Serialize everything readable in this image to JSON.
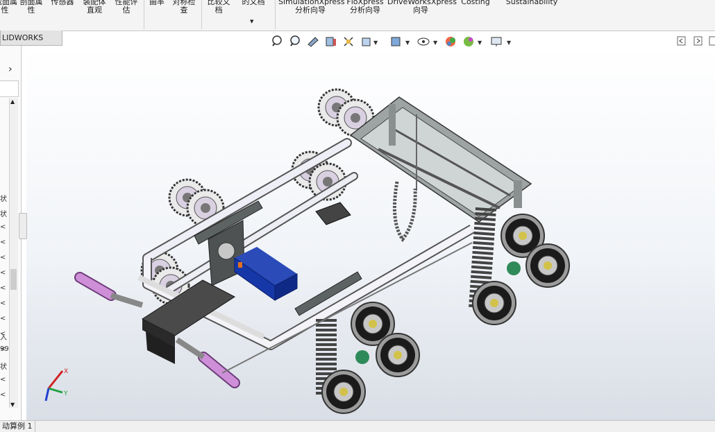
{
  "ribbon": {
    "b1": "截面属\n性",
    "b2": "剖面属\n性",
    "b3": "传感器",
    "b4": "装配体\n直观",
    "b5": "性能评\n估",
    "b6": "曲率",
    "b7": "对称检\n查",
    "b8": "比较文\n档",
    "b9": "的文档",
    "b10": "SimulationXpress\n分析向导",
    "b11": "FloXpress\n分析向导",
    "b12": "DriveWorksXpress\n向导",
    "b13": "Costing",
    "b14": "Sustainability"
  },
  "tab": {
    "label": "LIDWORKS MBD"
  },
  "feature_tree": {
    "rows": [
      "状",
      "状",
      "<",
      "<",
      "<",
      "<",
      "<",
      "<",
      "<",
      "<",
      "<",
      "入",
      "99",
      "状",
      "<",
      "<"
    ]
  },
  "status": {
    "tab_label": "动算例 1"
  },
  "icons": [
    "zoom-to-fit-icon",
    "zoom-area-icon",
    "previous-view-icon",
    "section-view-icon",
    "dynamic-annotation-icon",
    "view-orientation-icon",
    "display-style-icon",
    "hide-show-icon",
    "edit-appearance-icon",
    "apply-scene-icon",
    "view-settings-icon"
  ]
}
